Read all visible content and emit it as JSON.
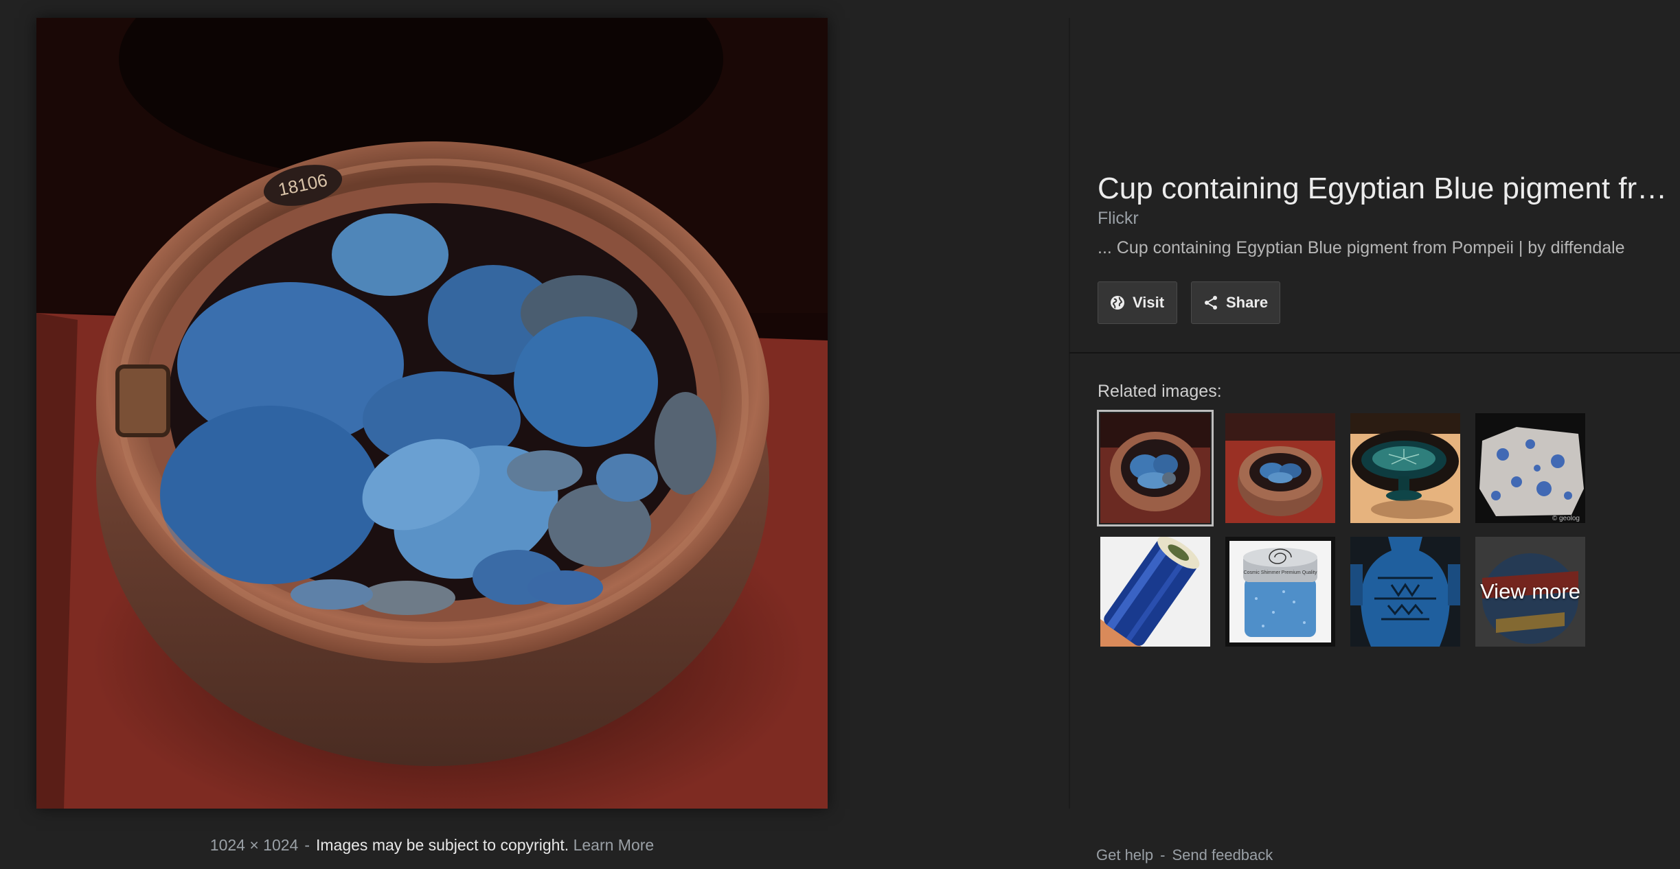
{
  "image": {
    "alt": "Cup containing Egyptian Blue pigment from Pompeii",
    "dimensions": "1024 × 1024",
    "copyright_notice": "Images may be subject to copyright.",
    "learn_more": "Learn More",
    "separator": "-",
    "pot_label": "18106"
  },
  "panel": {
    "title": "Cup containing Egyptian Blue pigment fr…",
    "source": "Flickr",
    "description": "... Cup containing Egyptian Blue pigment from Pompeii | by diffendale",
    "visit_label": "Visit",
    "share_label": "Share",
    "visit_icon": "globe-icon",
    "share_icon": "share-icon"
  },
  "related": {
    "label": "Related images:",
    "items": [
      {
        "name": "blue-pigment-cup",
        "selected": true
      },
      {
        "name": "blue-pigment-cup-red"
      },
      {
        "name": "egyptian-blue-footed-dish"
      },
      {
        "name": "blue-speckled-rock",
        "watermark": "© geolog"
      },
      {
        "name": "blue-glass-rod"
      },
      {
        "name": "blue-glitter-jar",
        "jar_text": "Cosmic Shimmer Premium Quality"
      },
      {
        "name": "blue-faience-vase"
      },
      {
        "name": "view-more",
        "label": "View more"
      }
    ]
  },
  "footer": {
    "get_help": "Get help",
    "send_feedback": "Send feedback",
    "separator": "-"
  },
  "colors": {
    "background": "#222222",
    "pigment_blue": "#3b78b5",
    "pot_terracotta": "#9b5a43",
    "display_red": "#7e2b22"
  }
}
